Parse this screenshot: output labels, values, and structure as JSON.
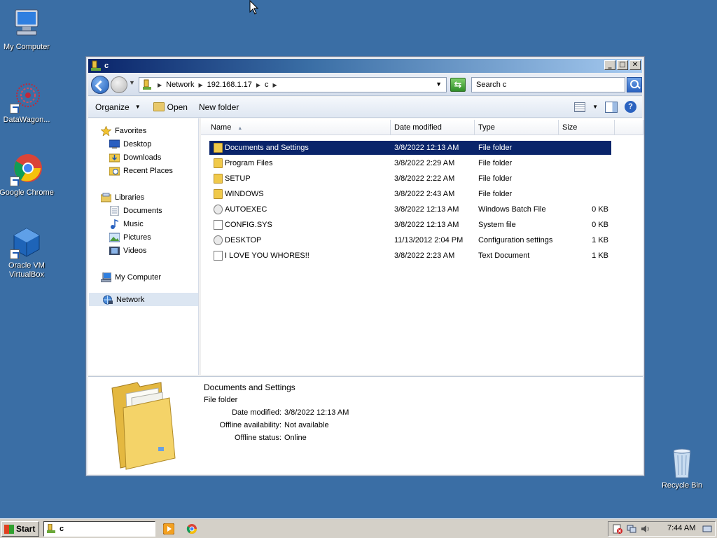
{
  "desktop": {
    "icons": [
      {
        "label": "My Computer"
      },
      {
        "label": "DataWagon..."
      },
      {
        "label": "Google Chrome"
      },
      {
        "label": "Oracle VM VirtualBox"
      },
      {
        "label": "Recycle Bin"
      }
    ]
  },
  "window": {
    "title": "c",
    "controls": {
      "minimize": "_",
      "maximize": "□",
      "close": "✕"
    }
  },
  "address": {
    "crumbs": [
      "Network",
      "192.168.1.17",
      "c"
    ],
    "search_placeholder": "Search c"
  },
  "commands": {
    "organize": "Organize",
    "open": "Open",
    "new_folder": "New folder"
  },
  "nav": {
    "favorites": "Favorites",
    "desktop": "Desktop",
    "downloads": "Downloads",
    "recent": "Recent Places",
    "libraries": "Libraries",
    "documents": "Documents",
    "music": "Music",
    "pictures": "Pictures",
    "videos": "Videos",
    "my_computer": "My Computer",
    "network": "Network"
  },
  "columns": {
    "name": "Name",
    "date": "Date modified",
    "type": "Type",
    "size": "Size"
  },
  "files": [
    {
      "name": "Documents and Settings",
      "date": "3/8/2022 12:13 AM",
      "type": "File folder",
      "size": "",
      "icon": "folder"
    },
    {
      "name": "Program Files",
      "date": "3/8/2022 2:29 AM",
      "type": "File folder",
      "size": "",
      "icon": "folder"
    },
    {
      "name": "SETUP",
      "date": "3/8/2022 2:22 AM",
      "type": "File folder",
      "size": "",
      "icon": "folder"
    },
    {
      "name": "WINDOWS",
      "date": "3/8/2022 2:43 AM",
      "type": "File folder",
      "size": "",
      "icon": "folder"
    },
    {
      "name": "AUTOEXEC",
      "date": "3/8/2022 12:13 AM",
      "type": "Windows Batch File",
      "size": "0 KB",
      "icon": "gear"
    },
    {
      "name": "CONFIG.SYS",
      "date": "3/8/2022 12:13 AM",
      "type": "System file",
      "size": "0 KB",
      "icon": "file"
    },
    {
      "name": "DESKTOP",
      "date": "11/13/2012 2:04 PM",
      "type": "Configuration settings",
      "size": "1 KB",
      "icon": "gear"
    },
    {
      "name": "I LOVE YOU WHORES!!",
      "date": "3/8/2022 2:23 AM",
      "type": "Text Document",
      "size": "1 KB",
      "icon": "file"
    }
  ],
  "details": {
    "name": "Documents and Settings",
    "type": "File folder",
    "date_label": "Date modified:",
    "date_value": "3/8/2022 12:13 AM",
    "offline_avail_label": "Offline availability:",
    "offline_avail_value": "Not available",
    "offline_status_label": "Offline status:",
    "offline_status_value": "Online"
  },
  "taskbar": {
    "start": "Start",
    "task": "c",
    "clock": "7:44 AM"
  },
  "colors": {
    "desktop": "#3a6ea5",
    "selection": "#0a246a"
  }
}
